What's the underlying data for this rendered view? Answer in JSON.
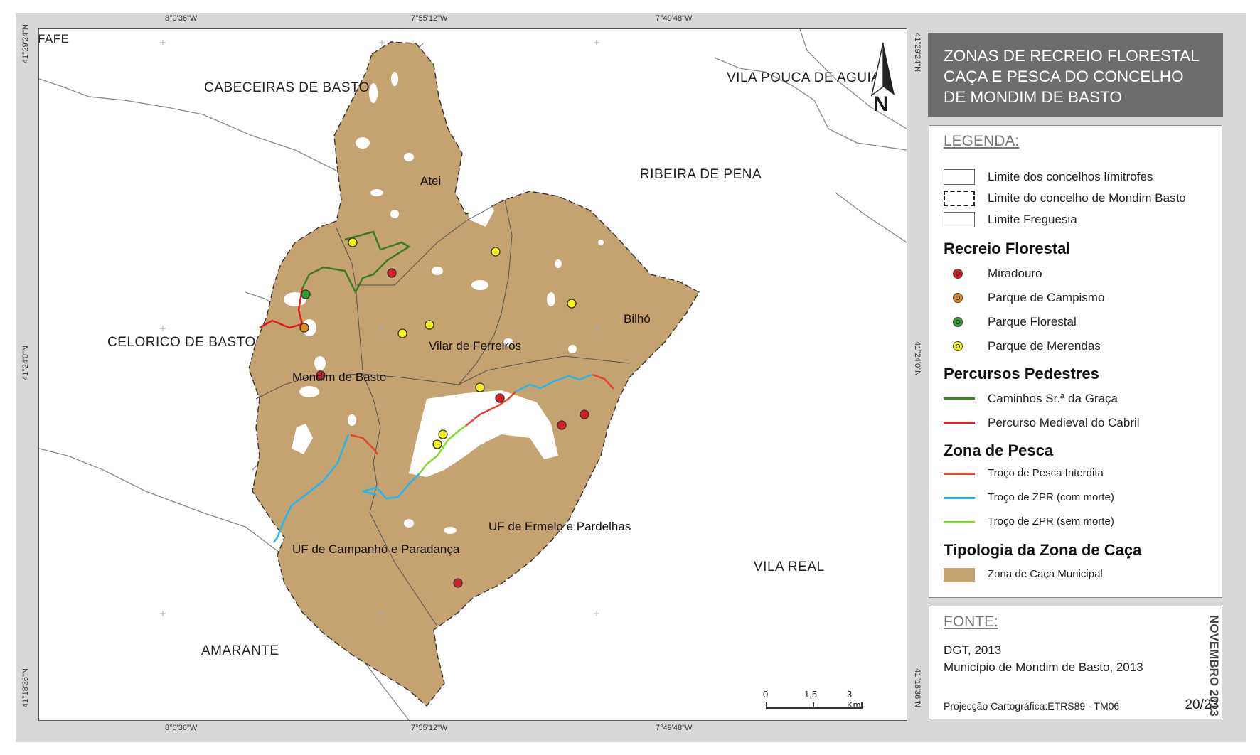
{
  "title": [
    "ZONAS DE RECREIO FLORESTAL",
    "CAÇA E PESCA DO CONCELHO",
    "DE MONDIM DE BASTO"
  ],
  "coordinates": {
    "top": [
      "8°0'36\"W",
      "7°55'12\"W",
      "7°49'48\"W"
    ],
    "bottom": [
      "8°0'36\"W",
      "7°55'12\"W",
      "7°49'48\"W"
    ],
    "left": [
      "41°29'24\"N",
      "41°24'0\"N",
      "41°18'36\"N"
    ],
    "right": [
      "41°29'24\"N",
      "41°24'0\"N",
      "41°18'36\"N"
    ]
  },
  "neighbors": {
    "fafe": "FAFE",
    "cabeceiras": "CABECEIRAS DE BASTO",
    "vila_pouca": "VILA POUCA DE AGUIAR",
    "ribeira": "RIBEIRA DE PENA",
    "celorico": "CELORICO DE BASTO",
    "vila_real": "VILA REAL",
    "amarante": "AMARANTE"
  },
  "parishes": {
    "atei": "Atei",
    "bilho": "Bilhó",
    "vilar": "Vilar de Ferreiros",
    "mondim": "Mondim de Basto",
    "campanho": "UF de Campanhó e Paradança",
    "ermelo": "UF de Ermelo e Pardelhas"
  },
  "north_label": "N",
  "legend": {
    "header": "LEGENDA:",
    "limits": [
      "Limite dos concelhos límitrofes",
      "Limite do concelho de Mondim Basto",
      "Limite Freguesia"
    ],
    "recreio_title": "Recreio Florestal",
    "recreio": [
      "Miradouro",
      "Parque de Campismo",
      "Parque Florestal",
      "Parque de Merendas"
    ],
    "percursos_title": "Percursos Pedestres",
    "percursos": [
      "Caminhos Sr.ª da Graça",
      "Percurso  Medieval do Cabril"
    ],
    "pesca_title": "Zona de Pesca",
    "pesca": [
      "Troço de Pesca Interdita",
      "Troço de ZPR (com morte)",
      "Troço de ZPR (sem morte)"
    ],
    "caca_title": "Tipologia da Zona de Caça",
    "caca": [
      "Zona de Caça Municipal"
    ]
  },
  "colors": {
    "hunting_zone": "#c4a370",
    "miradouro": "#d81f26",
    "campismo": "#e08a1e",
    "florestal": "#2e9e2e",
    "merendas": "#f2f21a",
    "caminhos": "#3a8a1a",
    "medieval": "#e21b1b",
    "pesca_interdita": "#e8452a",
    "zpr_com_morte": "#29b6e8",
    "zpr_sem_morte": "#7fdc2a"
  },
  "fonte": {
    "header": "FONTE:",
    "lines": [
      "DGT, 2013",
      "Município de Mondim de Basto, 2013"
    ],
    "projection": "Projecção Cartográfica:ETRS89 - TM06",
    "date": "NOVEMBRO 2013",
    "page": "20/23"
  },
  "scale": {
    "labels": [
      "0",
      "1,5",
      "3 Km"
    ]
  }
}
